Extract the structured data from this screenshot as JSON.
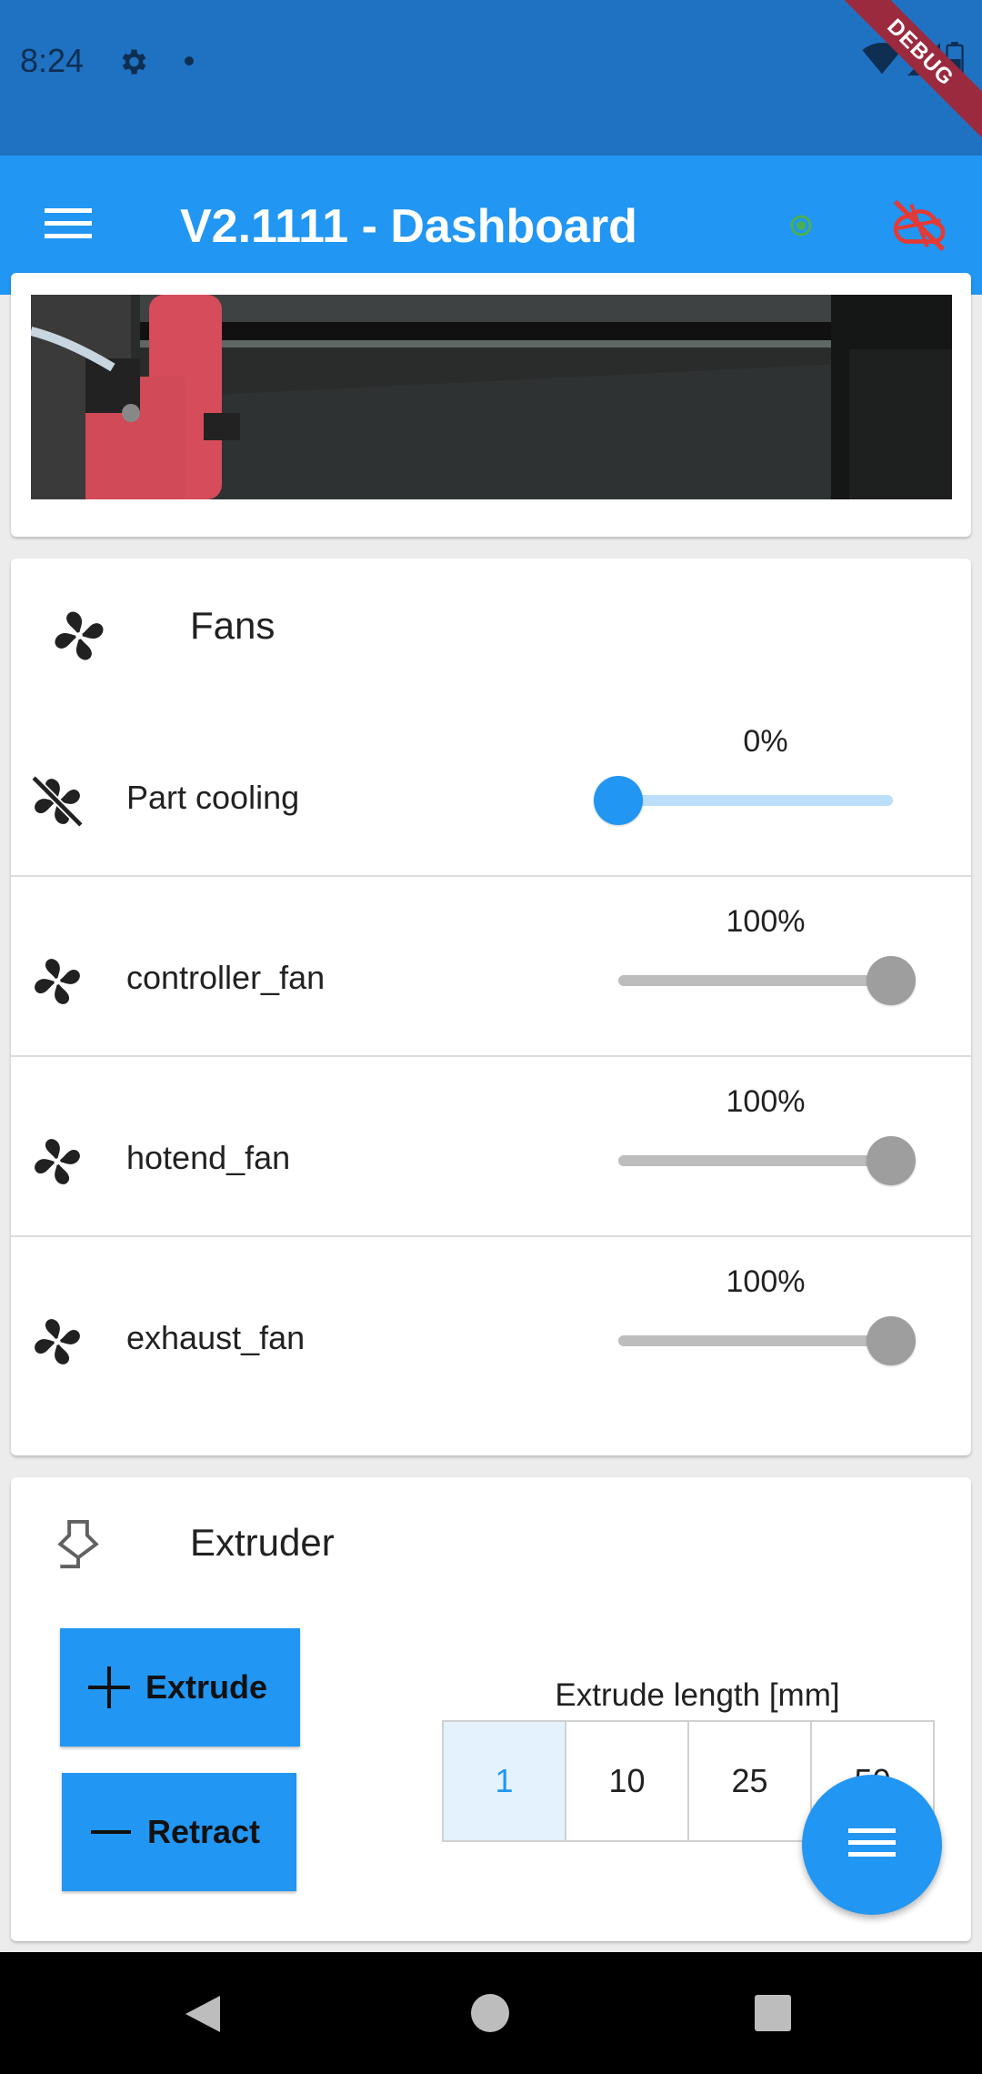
{
  "status_bar": {
    "time": "8:24",
    "icons": [
      "gear-icon",
      "notification-dot-icon",
      "wifi-icon",
      "signal-icon",
      "battery-icon"
    ],
    "debug_banner": "DEBUG"
  },
  "app_bar": {
    "title": "V2.1111 - Dashboard",
    "menu_icon": "menu-icon",
    "connection_icon": "status-dot-icon",
    "connection_color": "#4caf50",
    "action_icon": "cloud-off-icon",
    "action_color": "#e53935"
  },
  "fans": {
    "title": "Fans",
    "items": [
      {
        "label": "Part cooling",
        "value_text": "0%",
        "level": 0,
        "enabled": true,
        "icon": "fan-off-icon"
      },
      {
        "label": "controller_fan",
        "value_text": "100%",
        "level": 1,
        "enabled": false,
        "icon": "fan-icon"
      },
      {
        "label": "hotend_fan",
        "value_text": "100%",
        "level": 1,
        "enabled": false,
        "icon": "fan-icon"
      },
      {
        "label": "exhaust_fan",
        "value_text": "100%",
        "level": 1,
        "enabled": false,
        "icon": "fan-icon"
      }
    ]
  },
  "extruder": {
    "title": "Extruder",
    "extrude_label": "Extrude",
    "retract_label": "Retract",
    "length_title": "Extrude length [mm]",
    "length_options": [
      "1",
      "10",
      "25",
      "50"
    ],
    "selected_length": "1"
  },
  "colors": {
    "primary": "#2196f3",
    "status_bar": "#1f71c2"
  }
}
